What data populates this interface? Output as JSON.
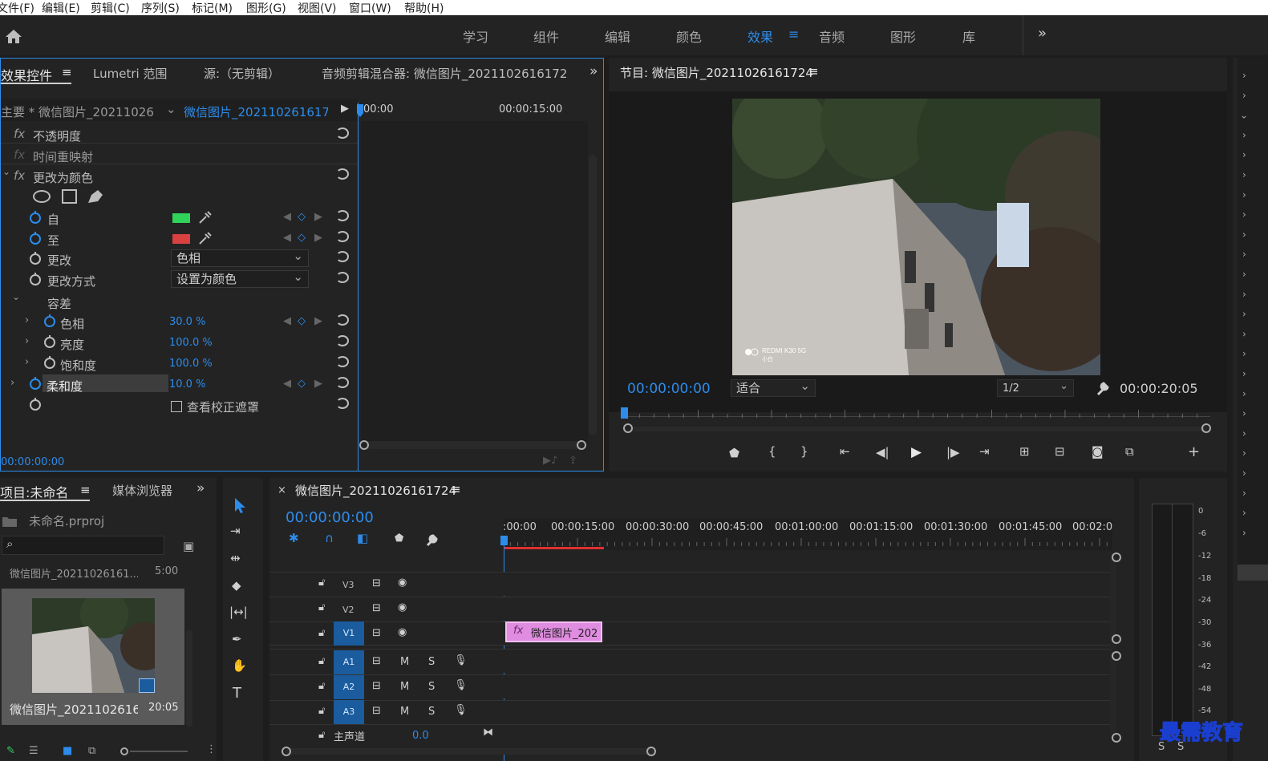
{
  "menu": [
    "文件(F)",
    "编辑(E)",
    "剪辑(C)",
    "序列(S)",
    "标记(M)",
    "图形(G)",
    "视图(V)",
    "窗口(W)",
    "帮助(H)"
  ],
  "workspaces": [
    "学习",
    "组件",
    "编辑",
    "颜色",
    "效果",
    "音频",
    "图形",
    "库"
  ],
  "active_workspace": "效果",
  "effect_panel": {
    "tabs": [
      "效果控件",
      "Lumetri 范围",
      "源:（无剪辑）",
      "音频剪辑混合器: 微信图片_2021102616172"
    ],
    "master": "主要 * 微信图片_20211026...",
    "clip": "微信图片_20211026161​7...",
    "time_start": "00:00",
    "time_mid": "00:00:15:00",
    "rows": {
      "opacity": "不透明度",
      "remap": "时间重映射",
      "change_to_color": "更改为颜色",
      "from": "自",
      "to": "至",
      "change": "更改",
      "change_value": "色相",
      "change_by": "更改方式",
      "change_by_value": "设置为颜色",
      "tolerance": "容差",
      "hue": "色相",
      "hue_value": "30.0 %",
      "lightness": "亮度",
      "lightness_value": "100.0 %",
      "saturation": "饱和度",
      "saturation_value": "100.0 %",
      "softness": "柔和度",
      "softness_value": "10.0 %",
      "show_mask": "查看校正遮罩"
    },
    "fx": "fx",
    "timecode": "00:00:00:00",
    "from_color": "#2fd35a",
    "to_color": "#d94040"
  },
  "program": {
    "title": "节目: 微信图片_20211026161724",
    "timecode": "00:00:00:00",
    "fit": "适合",
    "quality": "1/2",
    "duration": "00:00:20:05",
    "watermark": "REDMI K30 5G",
    "watermark_sub": "小白"
  },
  "project": {
    "tabs": [
      "项目:未命名",
      "媒体浏览器"
    ],
    "file": "未命名.prproj",
    "item_top": "微信图片_20211026161...",
    "item_top_dur": "5:00",
    "item_name": "微信图片_202110261​6...",
    "item_dur": "20:05"
  },
  "timeline": {
    "title": "微信图片_20211026161724",
    "timecode": "00:00:00:00",
    "ruler": [
      ":00:00",
      "00:00:15:00",
      "00:00:30:00",
      "00:00:45:00",
      "00:01:00:00",
      "00:01:15:00",
      "00:01:30:00",
      "00:01:45:00",
      "00:02:0"
    ],
    "tracks_v": [
      "V3",
      "V2",
      "V1"
    ],
    "tracks_a": [
      "A1",
      "A2",
      "A3"
    ],
    "master": "主声道",
    "master_value": "0.0",
    "clip_label": "微信图片_202",
    "m": "M",
    "s": "S"
  },
  "meter": {
    "ticks": [
      "0",
      "-6",
      "-12",
      "-18",
      "-24",
      "-30",
      "-36",
      "-42",
      "-48",
      "-54"
    ],
    "solo": [
      "S",
      "S"
    ]
  },
  "watermark": "最需教育"
}
